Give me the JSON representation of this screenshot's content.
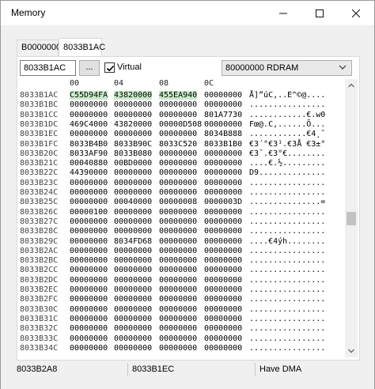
{
  "window": {
    "title": "Memory"
  },
  "tabs": [
    {
      "label": "B0000000"
    },
    {
      "label": "8033B1AC"
    }
  ],
  "toolbar": {
    "address": "8033B1AC",
    "dots_label": "...",
    "virtual_label": "Virtual",
    "virtual_checked": true,
    "region": "80000000 RDRAM"
  },
  "columns": [
    "00",
    "04",
    "08",
    "0C"
  ],
  "rows": [
    {
      "addr": "8033B1AC",
      "w": [
        "C55D94FA",
        "43820000",
        "455EA940",
        "00000000"
      ],
      "hl": [
        true,
        true,
        true,
        false
      ],
      "ascii": "Å]”úC‚..E^©@...."
    },
    {
      "addr": "8033B1BC",
      "w": [
        "00000000",
        "00000000",
        "00000000",
        "00000000"
      ],
      "hl": [
        false,
        false,
        false,
        false
      ],
      "ascii": "................"
    },
    {
      "addr": "8033B1CC",
      "w": [
        "00000000",
        "00000000",
        "00000000",
        "801A7730"
      ],
      "hl": [
        false,
        false,
        false,
        false
      ],
      "ascii": "............€.w0"
    },
    {
      "addr": "8033B1DC",
      "w": [
        "469C4000",
        "43820000",
        "00000D508",
        "00000000"
      ],
      "hl": [
        false,
        false,
        false,
        false
      ],
      "ascii": "Fœ@.C‚......Õ..."
    },
    {
      "addr": "8033B1EC",
      "w": [
        "00000000",
        "00000000",
        "00000000",
        "8034B888"
      ],
      "hl": [
        false,
        false,
        false,
        false
      ],
      "ascii": "............€4¸ˆ"
    },
    {
      "addr": "8033B1FC",
      "w": [
        "8033B4B0",
        "8033B90C",
        "8033C520",
        "8033B1B0"
      ],
      "hl": [
        false,
        false,
        false,
        false
      ],
      "ascii": "€3´°€3¹.€3Å €3±°"
    },
    {
      "addr": "8033B20C",
      "w": [
        "8033AF90",
        "8033B080",
        "00000000",
        "00000000"
      ],
      "hl": [
        false,
        false,
        false,
        false
      ],
      "ascii": "€3¯.€3°€........"
    },
    {
      "addr": "8033B21C",
      "w": [
        "00040880",
        "00BD0000",
        "00000000",
        "00000000"
      ],
      "hl": [
        false,
        false,
        false,
        false
      ],
      "ascii": "....€.½........."
    },
    {
      "addr": "8033B22C",
      "w": [
        "44390000",
        "00000000",
        "00000000",
        "00000000"
      ],
      "hl": [
        false,
        false,
        false,
        false
      ],
      "ascii": "D9.............."
    },
    {
      "addr": "8033B23C",
      "w": [
        "00000000",
        "00000000",
        "00000000",
        "00000000"
      ],
      "hl": [
        false,
        false,
        false,
        false
      ],
      "ascii": "................"
    },
    {
      "addr": "8033B24C",
      "w": [
        "00000000",
        "00000000",
        "00000000",
        "00000000"
      ],
      "hl": [
        false,
        false,
        false,
        false
      ],
      "ascii": "................"
    },
    {
      "addr": "8033B25C",
      "w": [
        "00000000",
        "00040000",
        "00000008",
        "0000003D"
      ],
      "hl": [
        false,
        false,
        false,
        false
      ],
      "ascii": "...............="
    },
    {
      "addr": "8033B26C",
      "w": [
        "00000100",
        "00000000",
        "00000000",
        "00000000"
      ],
      "hl": [
        false,
        false,
        false,
        false
      ],
      "ascii": "................"
    },
    {
      "addr": "8033B27C",
      "w": [
        "00000000",
        "00000000",
        "00000000",
        "00000000"
      ],
      "hl": [
        false,
        false,
        false,
        false
      ],
      "ascii": "................"
    },
    {
      "addr": "8033B28C",
      "w": [
        "00000000",
        "00000000",
        "00000000",
        "00000000"
      ],
      "hl": [
        false,
        false,
        false,
        false
      ],
      "ascii": "................"
    },
    {
      "addr": "8033B29C",
      "w": [
        "00000000",
        "8034FD68",
        "00000000",
        "00000000"
      ],
      "hl": [
        false,
        false,
        false,
        false
      ],
      "ascii": "....€4ýh........"
    },
    {
      "addr": "8033B2AC",
      "w": [
        "00000000",
        "00000000",
        "00000000",
        "00000000"
      ],
      "hl": [
        false,
        false,
        false,
        false
      ],
      "ascii": "................"
    },
    {
      "addr": "8033B2BC",
      "w": [
        "00000000",
        "00000000",
        "00000000",
        "00000000"
      ],
      "hl": [
        false,
        false,
        false,
        false
      ],
      "ascii": "................"
    },
    {
      "addr": "8033B2CC",
      "w": [
        "00000000",
        "00000000",
        "00000000",
        "00000000"
      ],
      "hl": [
        false,
        false,
        false,
        false
      ],
      "ascii": "................"
    },
    {
      "addr": "8033B2DC",
      "w": [
        "00000000",
        "00000000",
        "00000000",
        "00000000"
      ],
      "hl": [
        false,
        false,
        false,
        false
      ],
      "ascii": "................"
    },
    {
      "addr": "8033B2EC",
      "w": [
        "00000000",
        "00000000",
        "00000000",
        "00000000"
      ],
      "hl": [
        false,
        false,
        false,
        false
      ],
      "ascii": "................"
    },
    {
      "addr": "8033B2FC",
      "w": [
        "00000000",
        "00000000",
        "00000000",
        "00000000"
      ],
      "hl": [
        false,
        false,
        false,
        false
      ],
      "ascii": "................"
    },
    {
      "addr": "8033B30C",
      "w": [
        "00000000",
        "00000000",
        "00000000",
        "00000000"
      ],
      "hl": [
        false,
        false,
        false,
        false
      ],
      "ascii": "................"
    },
    {
      "addr": "8033B31C",
      "w": [
        "00000000",
        "00000000",
        "00000000",
        "00000000"
      ],
      "hl": [
        false,
        false,
        false,
        false
      ],
      "ascii": "................"
    },
    {
      "addr": "8033B32C",
      "w": [
        "00000000",
        "00000000",
        "00000000",
        "00000000"
      ],
      "hl": [
        false,
        false,
        false,
        false
      ],
      "ascii": "................"
    },
    {
      "addr": "8033B33C",
      "w": [
        "00000000",
        "00000000",
        "00000000",
        "00000000"
      ],
      "hl": [
        false,
        false,
        false,
        false
      ],
      "ascii": "................"
    },
    {
      "addr": "8033B34C",
      "w": [
        "00000000",
        "00000000",
        "00000000",
        "00000000"
      ],
      "hl": [
        false,
        false,
        false,
        false
      ],
      "ascii": "................"
    }
  ],
  "status": {
    "left": "8033B2A8",
    "middle": "8033B1EC",
    "right": "Have DMA"
  },
  "colors": {
    "highlight": "#c9ebc9",
    "window_bg": "#f0f0f0"
  },
  "icons": [
    "minimize-icon",
    "maximize-icon",
    "close-icon",
    "checkmark-icon",
    "chevron-down-icon",
    "scroll-up-icon",
    "scroll-down-icon"
  ]
}
